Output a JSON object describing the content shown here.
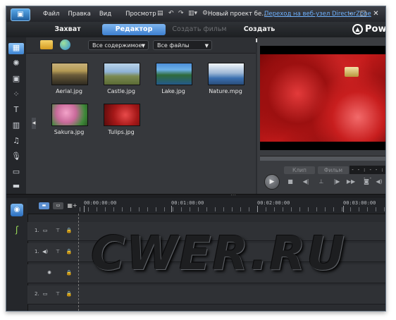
{
  "titlebar": {
    "menu": [
      "Файл",
      "Правка",
      "Вид",
      "Просмотр"
    ],
    "project_title": "Новый проект бе...",
    "directorzone_link": "Переход на веб-узел DirectorZone"
  },
  "modes": {
    "capture": "Захват",
    "editor": "Редактор",
    "produce": "Создать фильм",
    "disc": "Создать диск",
    "brand": "Pow"
  },
  "library": {
    "content_filter": "Все содержимое",
    "file_filter": "Все файлы",
    "items": [
      {
        "name": "Aerial.jpg"
      },
      {
        "name": "Castle.jpg"
      },
      {
        "name": "Lake.jpg"
      },
      {
        "name": "Nature.mpg"
      },
      {
        "name": "Sakura.jpg"
      },
      {
        "name": "Tulips.jpg"
      }
    ]
  },
  "preview": {
    "tab_clip": "Клип",
    "tab_movie": "Фильм",
    "timecode": "- - : - - : - -"
  },
  "timeline": {
    "ruler": [
      "00:00:00:00",
      "00:01:00:00",
      "00:02:00:00",
      "00:03:00:00"
    ],
    "tracks": [
      {
        "num": "1."
      },
      {
        "num": "1."
      },
      {
        "num": ""
      },
      {
        "num": "2."
      }
    ]
  },
  "watermark": "CWER.RU"
}
